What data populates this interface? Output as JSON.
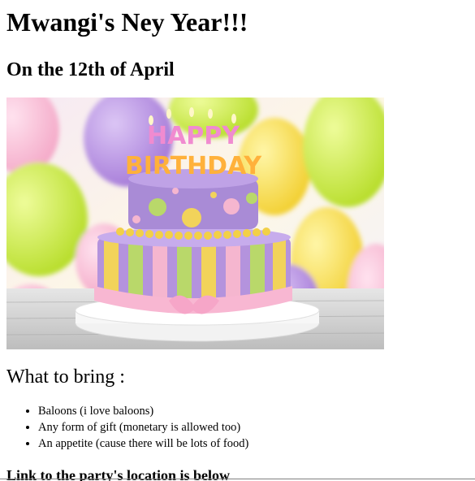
{
  "page": {
    "title": "Mwangi's Ney Year!!!",
    "date_line": "On the 12th of April",
    "image_alt": "Happy Birthday cake with candles in front of colorful balloons",
    "cake_candle_text_1": "HAPPY",
    "cake_candle_text_2": "BIRTHDAY",
    "bring_heading": "What to bring :",
    "bring_items": [
      "Baloons (i love baloons)",
      "Any form of gift (monetary is allowed too)",
      "An appetite (cause there will be lots of food)"
    ],
    "link_heading": "Link to the party's location is below"
  },
  "colors": {
    "balloon_green": "#c4e83a",
    "balloon_purple": "#b58be0",
    "balloon_yellow": "#f7e34a",
    "cake_purple": "#a98bd6",
    "cake_pink": "#f5b6cf",
    "cake_yellow": "#f2d35a",
    "cake_green": "#b9d86a"
  }
}
